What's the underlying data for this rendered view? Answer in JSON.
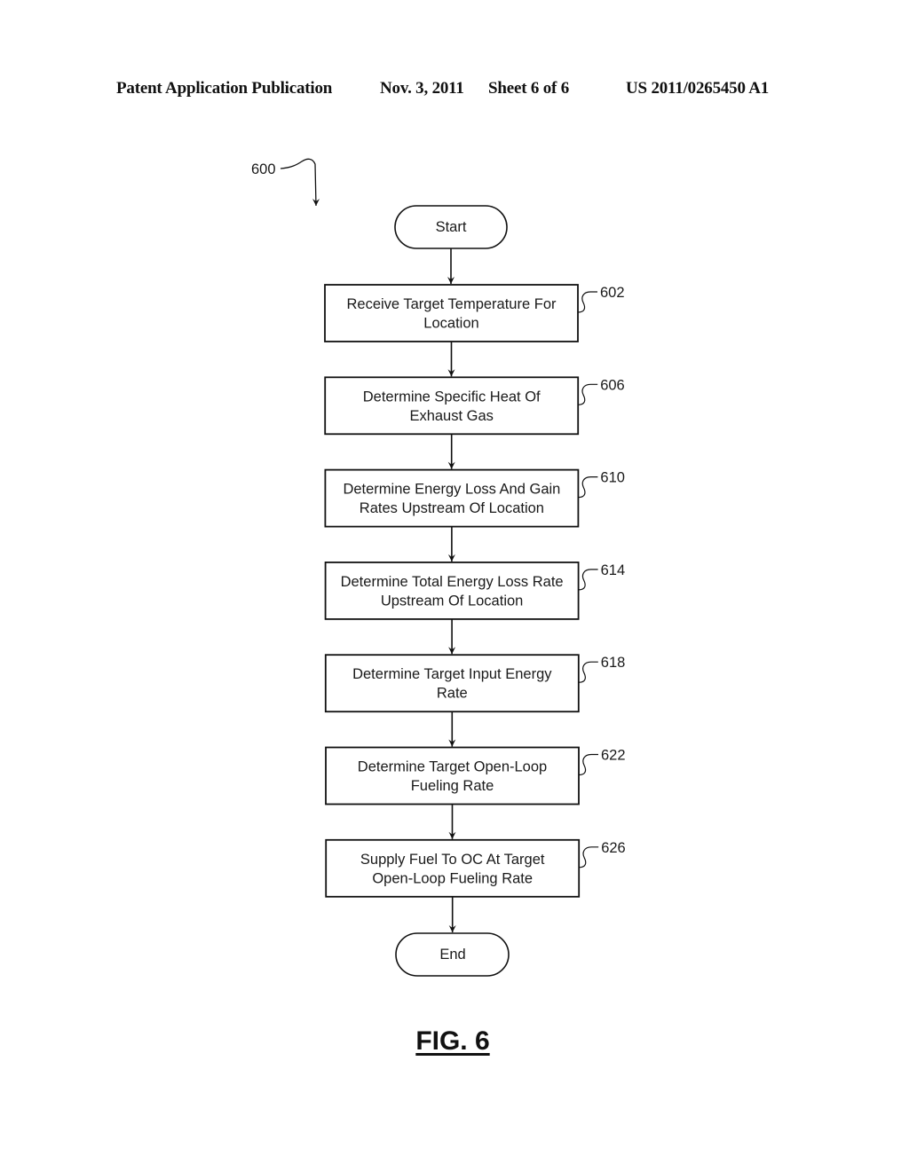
{
  "header": {
    "publication": "Patent Application Publication",
    "date": "Nov. 3, 2011",
    "sheet": "Sheet 6 of 6",
    "number": "US 2011/0265450 A1"
  },
  "diagram": {
    "reference": "600",
    "start_label": "Start",
    "end_label": "End",
    "steps": [
      {
        "ref": "602",
        "lines": [
          "Receive Target Temperature For",
          "Location"
        ]
      },
      {
        "ref": "606",
        "lines": [
          "Determine Specific Heat Of",
          "Exhaust Gas"
        ]
      },
      {
        "ref": "610",
        "lines": [
          "Determine Energy Loss And Gain",
          "Rates Upstream Of Location"
        ]
      },
      {
        "ref": "614",
        "lines": [
          "Determine Total Energy Loss Rate",
          "Upstream Of Location"
        ]
      },
      {
        "ref": "618",
        "lines": [
          "Determine Target Input Energy",
          "Rate"
        ]
      },
      {
        "ref": "622",
        "lines": [
          "Determine Target Open-Loop",
          "Fueling Rate"
        ]
      },
      {
        "ref": "626",
        "lines": [
          "Supply Fuel To OC At Target",
          "Open-Loop Fueling Rate"
        ]
      }
    ]
  },
  "figure_label": "FIG. 6"
}
